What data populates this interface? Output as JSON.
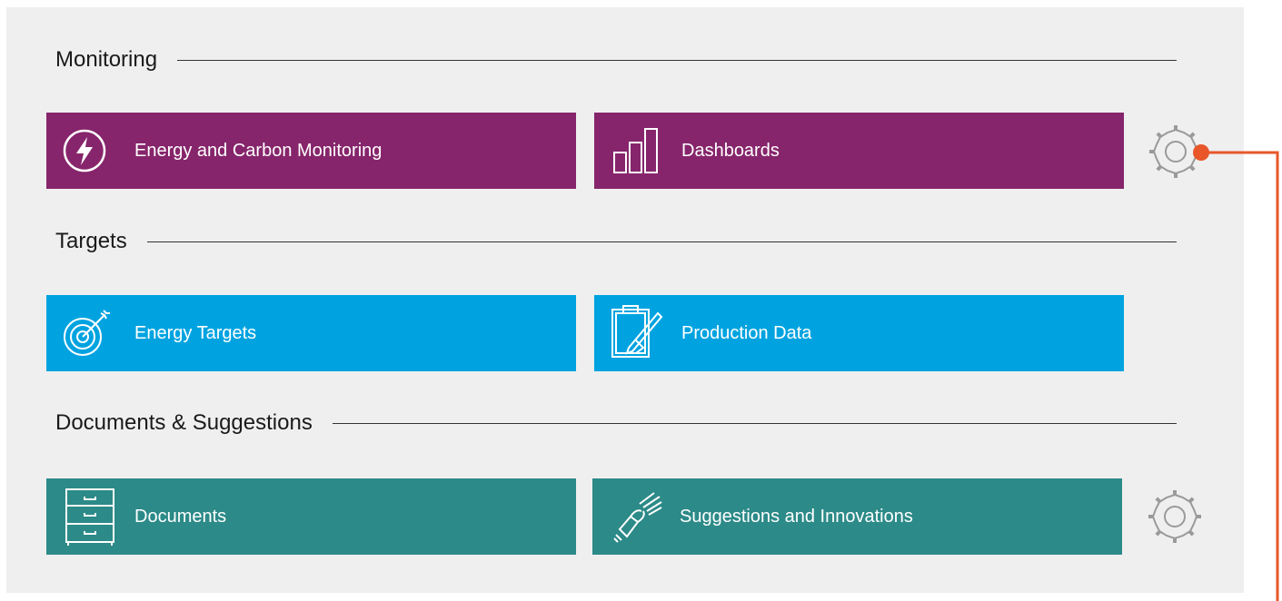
{
  "sections": [
    {
      "title": "Monitoring"
    },
    {
      "title": "Targets"
    },
    {
      "title": "Documents & Suggestions"
    }
  ],
  "tiles": {
    "energy_carbon": {
      "label": "Energy and Carbon Monitoring",
      "icon": "lightning-icon"
    },
    "dashboards": {
      "label": "Dashboards",
      "icon": "bar-chart-icon"
    },
    "energy_targets": {
      "label": "Energy Targets",
      "icon": "target-icon"
    },
    "production_data": {
      "label": "Production Data",
      "icon": "clipboard-icon"
    },
    "documents": {
      "label": "Documents",
      "icon": "cabinet-icon"
    },
    "suggestions": {
      "label": "Suggestions and Innovations",
      "icon": "lightbulb-icon"
    }
  },
  "colors": {
    "monitoring": "#86256b",
    "targets": "#00a3e0",
    "documents": "#2c8a88",
    "connector": "#e8562a",
    "gear": "#9a9a9a"
  }
}
